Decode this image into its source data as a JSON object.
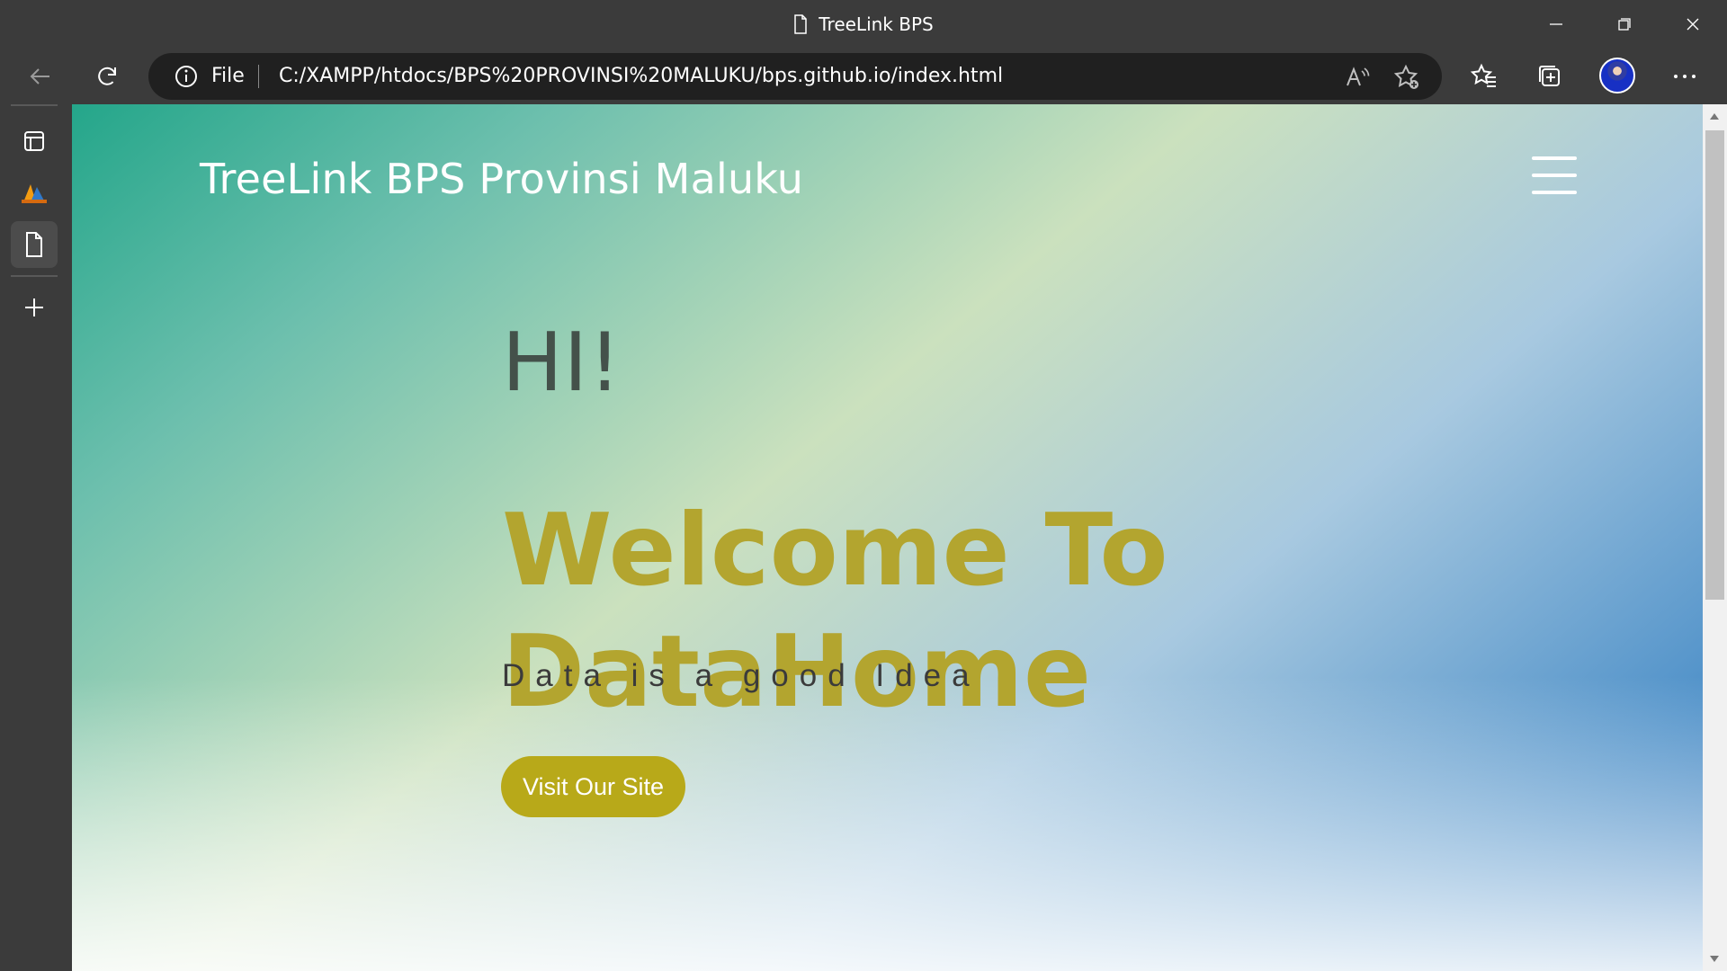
{
  "window": {
    "title": "TreeLink BPS"
  },
  "icons": {
    "title": "document-icon",
    "minimize": "minimize-icon",
    "restore": "restore-icon",
    "close": "close-icon",
    "back": "back-arrow-icon",
    "reload": "reload-icon",
    "info": "info-icon",
    "read_aloud": "read-aloud-icon",
    "add_favorite": "add-favorite-icon",
    "favorites": "favorites-icon",
    "collections": "collections-icon",
    "profile": "profile-icon",
    "more": "more-icon",
    "tab_actions": "tab-actions-icon",
    "site_tab": "site-favicon-icon",
    "page_tab": "document-tab-icon",
    "new_tab": "plus-icon",
    "menu": "hamburger-menu-icon"
  },
  "address_bar": {
    "scheme_label": "File",
    "url": "C:/XAMPP/htdocs/BPS%20PROVINSI%20MALUKU/bps.github.io/index.html"
  },
  "page": {
    "brand": "TreeLink BPS Provinsi Maluku",
    "hero": {
      "greeting": "HI!",
      "heading": "Welcome To DataHome",
      "subtitle": "Data is a good Idea",
      "button_label": "Visit Our Site"
    }
  },
  "colors": {
    "accent_gold": "#b8a919",
    "heading_gold": "#b3a52f",
    "browser_chrome": "#3b3b3b",
    "address_bg": "#202020",
    "gradient_teal": "#24a68a",
    "gradient_blue": "#2a74ba"
  }
}
